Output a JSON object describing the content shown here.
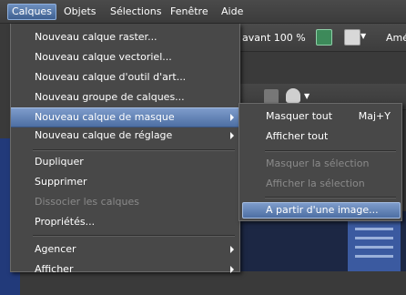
{
  "menubar": {
    "items": [
      "Calques",
      "Objets",
      "Sélections",
      "Fenêtre",
      "Aide"
    ]
  },
  "toolbar": {
    "zoom_label": "avant 100 %",
    "right_label": "Amé"
  },
  "layers_menu": {
    "items": [
      {
        "label": "Nouveau calque raster..."
      },
      {
        "label": "Nouveau calque vectoriel..."
      },
      {
        "label": "Nouveau calque d'outil d'art..."
      },
      {
        "label": "Nouveau groupe de calques..."
      },
      {
        "label": "Nouveau calque de masque"
      },
      {
        "label": "Nouveau calque de réglage"
      },
      {
        "label": "Dupliquer"
      },
      {
        "label": "Supprimer"
      },
      {
        "label": "Dissocier les calques"
      },
      {
        "label": "Propriétés..."
      },
      {
        "label": "Agencer"
      },
      {
        "label": "Afficher"
      }
    ]
  },
  "mask_submenu": {
    "items": [
      {
        "label": "Masquer tout",
        "shortcut": "Maj+Y"
      },
      {
        "label": "Afficher tout"
      },
      {
        "label": "Masquer la sélection"
      },
      {
        "label": "Afficher la sélection"
      },
      {
        "label": "A partir d'une image..."
      }
    ]
  },
  "colors": {
    "highlight": "#5f7fb3",
    "menu_bg": "#484848",
    "disabled_text": "#8a8a8a"
  }
}
